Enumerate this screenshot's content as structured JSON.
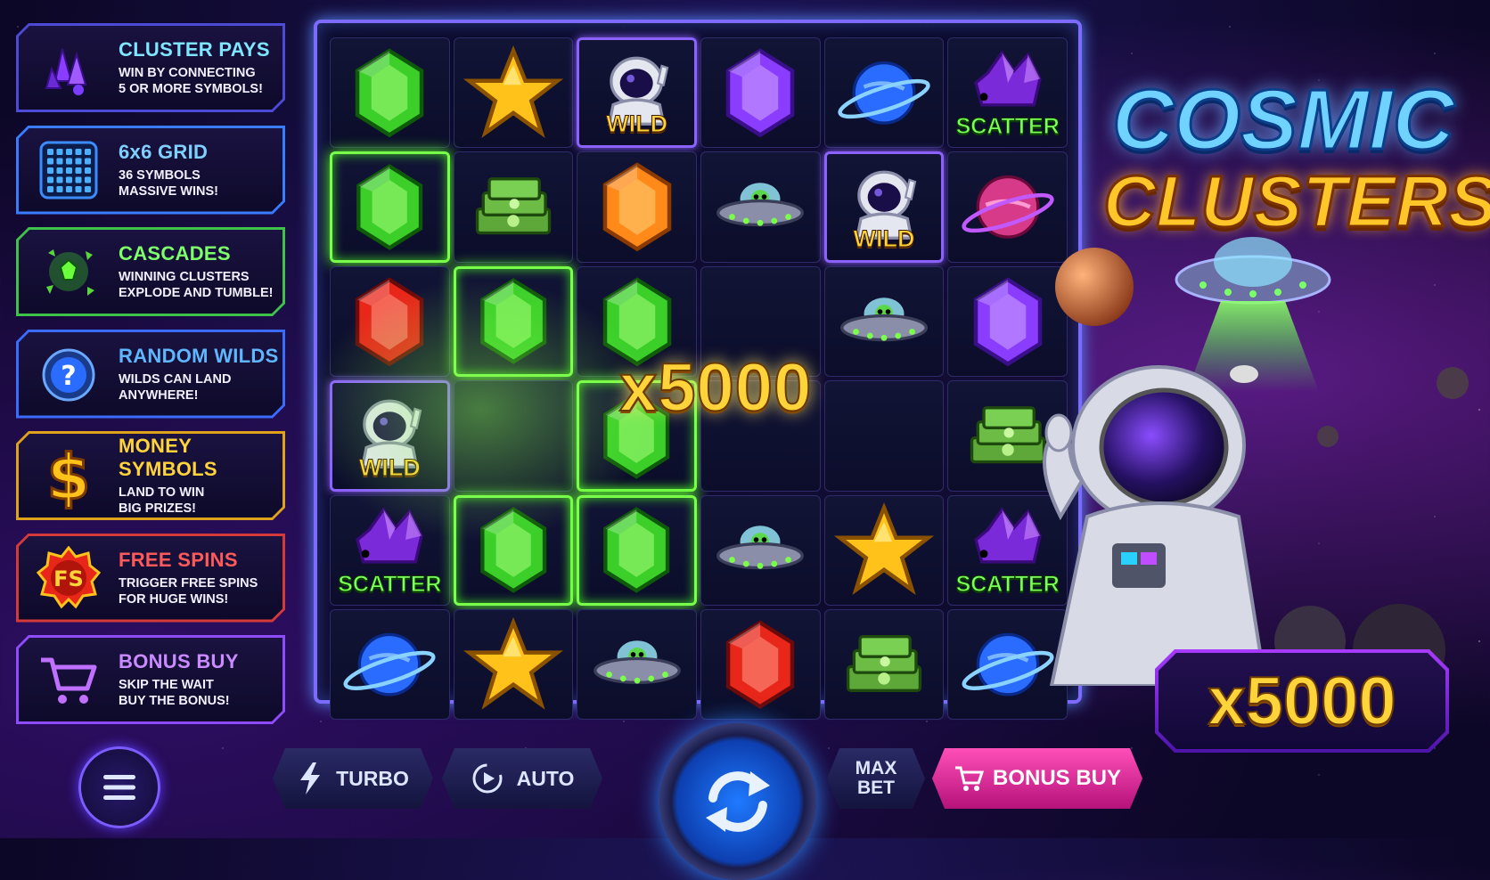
{
  "features": [
    {
      "title": "CLUSTER PAYS",
      "desc1": "WIN BY CONNECTING",
      "desc2": "5 OR MORE SYMBOLS!",
      "color": "#7fe6ff",
      "border": "#4d4bd6",
      "icon": "purple-crystal-icon"
    },
    {
      "title": "6x6 GRID",
      "desc1": "36 SYMBOLS",
      "desc2": "MASSIVE WINS!",
      "color": "#7fd0ff",
      "border": "#3a7cff",
      "icon": "grid-icon"
    },
    {
      "title": "CASCADES",
      "desc1": "WINNING CLUSTERS",
      "desc2": "EXPLODE AND TUMBLE!",
      "color": "#7dff6a",
      "border": "#3ec24a",
      "icon": "exploding-gem-icon"
    },
    {
      "title": "RANDOM WILDS",
      "desc1": "WILDS CAN LAND",
      "desc2": "ANYWHERE!",
      "color": "#5fb6ff",
      "border": "#3a6cff",
      "icon": "mystery-helmet-icon"
    },
    {
      "title": "MONEY SYMBOLS",
      "desc1": "LAND TO WIN",
      "desc2": "BIG PRIZES!",
      "color": "#ffd33a",
      "border": "#e0a21a",
      "icon": "dollar-icon"
    },
    {
      "title": "FREE SPINS",
      "desc1": "TRIGGER FREE SPINS",
      "desc2": "FOR HUGE WINS!",
      "color": "#ff5a5a",
      "border": "#d53a3a",
      "icon": "fs-badge-icon"
    },
    {
      "title": "BONUS BUY",
      "desc1": "SKIP THE WAIT",
      "desc2": "BUY THE BONUS!",
      "color": "#c98bff",
      "border": "#8f4cff",
      "icon": "cart-icon"
    }
  ],
  "grid": [
    [
      "green-gem",
      "gold-star",
      "wild",
      "purple-gem",
      "blue-planet",
      "scatter"
    ],
    [
      "green-gem",
      "cash-stack",
      "orange-gem",
      "ufo",
      "wild",
      "pink-planet"
    ],
    [
      "red-gem",
      "green-gem",
      "green-gem",
      "",
      "ufo",
      "purple-gem"
    ],
    [
      "wild",
      "",
      "green-gem",
      "",
      "",
      "cash-stack"
    ],
    [
      "scatter",
      "green-gem",
      "green-gem",
      "ufo",
      "gold-star",
      "scatter"
    ],
    [
      "blue-planet",
      "gold-star",
      "ufo",
      "red-gem",
      "cash-stack",
      "blue-planet"
    ]
  ],
  "win_cells": [
    "1-0",
    "2-1",
    "3-2",
    "4-1",
    "4-2"
  ],
  "labels": {
    "wild": "WILD",
    "scatter": "SCATTER"
  },
  "win_multiplier": "x5000",
  "logo": {
    "line1": "COSMIC",
    "line2": "CLUSTERS"
  },
  "max_multiplier": "x5000",
  "controls": {
    "turbo": "TURBO",
    "auto": "AUTO",
    "max_bet_1": "MAX",
    "max_bet_2": "BET",
    "bonus_buy": "BONUS BUY"
  },
  "colors": {
    "accent": "#7d6bff",
    "win_glow": "#7aff4a",
    "gold": "#ffd43a"
  }
}
